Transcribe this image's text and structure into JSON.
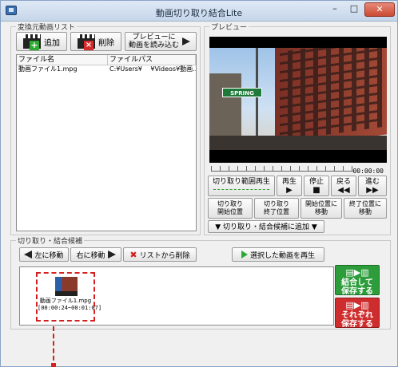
{
  "window": {
    "title": "動画切り取り結合Lite",
    "controls": {
      "minimize": "–",
      "maximize": "□",
      "close": "✕"
    }
  },
  "source": {
    "legend": "変換元動画リスト",
    "add_label": "追加",
    "delete_label": "削除",
    "load_preview_line1": "プレビューに",
    "load_preview_line2": "動画を読み込む",
    "table": {
      "headers": [
        "ファイル名",
        "ファイルパス"
      ],
      "rows": [
        [
          "動画ファイル1.mpg",
          "C:¥Users¥　 ¥Videos¥動画..."
        ]
      ]
    }
  },
  "preview": {
    "legend": "プレビュー",
    "sign_text": "SPRING",
    "time": "00:00:00",
    "buttons": {
      "cut_range_play": "切り取り範囲再生",
      "play": "再生",
      "stop": "停止",
      "back": "戻る",
      "forward": "進む",
      "cut_start_1": "切り取り",
      "cut_start_2": "開始位置",
      "cut_end_1": "切り取り",
      "cut_end_2": "終了位置",
      "move_start_1": "開始位置に",
      "move_start_2": "移動",
      "move_end_1": "終了位置に",
      "move_end_2": "移動",
      "add_to_candidates": "▼ 切り取り・結合候補に追加 ▼"
    },
    "glyphs": {
      "play": "▶",
      "stop": "■",
      "back": "◀◀",
      "forward": "▶▶"
    }
  },
  "candidates": {
    "legend": "切り取り・結合候補",
    "move_left": "左に移動",
    "move_right": "右に移動",
    "remove": "リストから削除",
    "play_selected": "選択した動画を再生",
    "items": [
      {
        "name": "動画ファイル1.mpg",
        "range": "[00:00:24~00:01:07]"
      }
    ],
    "merge_save": {
      "line1": "結合して",
      "line2": "保存する"
    },
    "separate_save": {
      "line1": "それぞれ",
      "line2": "保存する"
    }
  },
  "colors": {
    "accent_green": "#2c9d3a",
    "accent_red": "#cf2d2d",
    "selection_red": "#d42020"
  }
}
